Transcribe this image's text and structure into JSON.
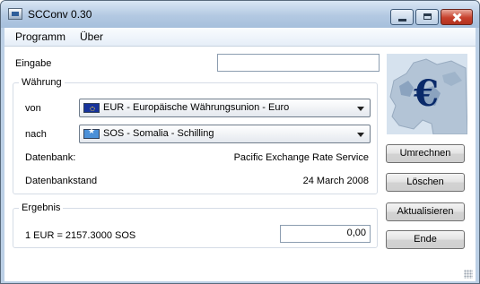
{
  "window": {
    "title": "SCConv 0.30"
  },
  "menu": {
    "items": [
      "Programm",
      "Über"
    ]
  },
  "input": {
    "label": "Eingabe",
    "value": ""
  },
  "currency": {
    "group_title": "Währung",
    "from_label": "von",
    "from_value": "EUR - Europäische Währungsunion - Euro",
    "to_label": "nach",
    "to_value": "SOS - Somalia - Schilling",
    "database_label": "Datenbank:",
    "database_value": "Pacific Exchange Rate Service",
    "database_date_label": "Datenbankstand",
    "database_date_value": "24 March 2008"
  },
  "result": {
    "group_title": "Ergebnis",
    "rate_text": "1 EUR = 2157.3000 SOS",
    "value": "0,00"
  },
  "logo": {
    "symbol": "€"
  },
  "buttons": {
    "convert": "Umrechnen",
    "clear": "Löschen",
    "update": "Aktualisieren",
    "exit": "Ende"
  }
}
